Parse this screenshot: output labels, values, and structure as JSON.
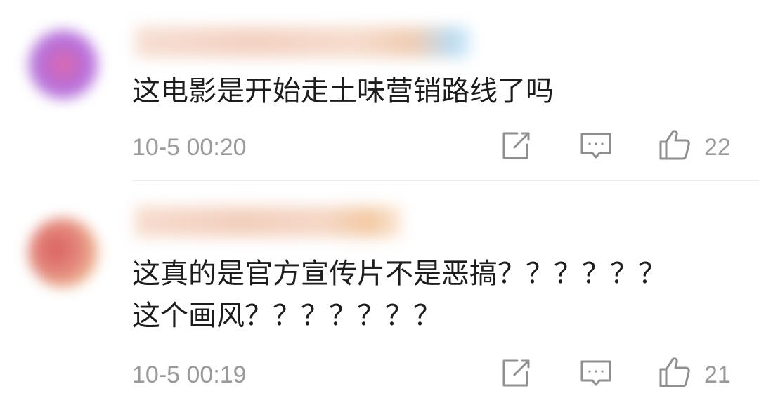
{
  "comments": [
    {
      "text_lines": [
        "这电影是开始走土味营销路线了吗"
      ],
      "time": "10-5 00:20",
      "icons": {
        "share": "share-icon",
        "reply": "comment-icon",
        "like": "thumbs-up-icon"
      },
      "likes": "22"
    },
    {
      "text_lines": [
        "这真的是官方宣传片不是恶搞？？？？？？",
        "这个画风？？？？？？？"
      ],
      "time": "10-5 00:19",
      "icons": {
        "share": "share-icon",
        "reply": "comment-icon",
        "like": "thumbs-up-icon"
      },
      "likes": "21"
    }
  ],
  "colors": {
    "text": "#1d1d1d",
    "meta": "#9a9a9a",
    "divider": "#ececec"
  }
}
